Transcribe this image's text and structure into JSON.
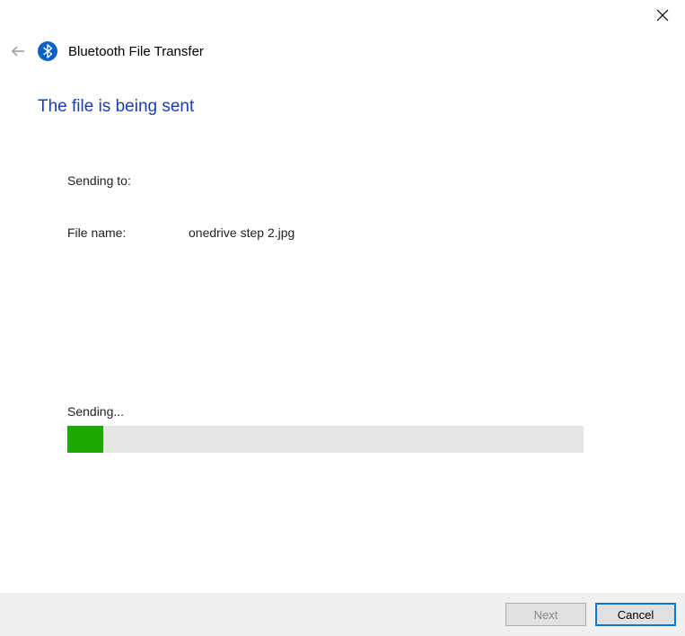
{
  "window": {
    "title": "Bluetooth File Transfer"
  },
  "page": {
    "heading": "The file is being sent"
  },
  "transfer": {
    "sending_to_label": "Sending to:",
    "sending_to_value": "",
    "file_name_label": "File name:",
    "file_name_value": "onedrive step 2.jpg"
  },
  "progress": {
    "label": "Sending...",
    "percent": 7
  },
  "footer": {
    "next_label": "Next",
    "cancel_label": "Cancel"
  },
  "colors": {
    "accent": "#0078d7",
    "heading": "#1a3fb0",
    "progress_fill": "#1aaa00",
    "bluetooth_bg": "#0a62c4"
  }
}
